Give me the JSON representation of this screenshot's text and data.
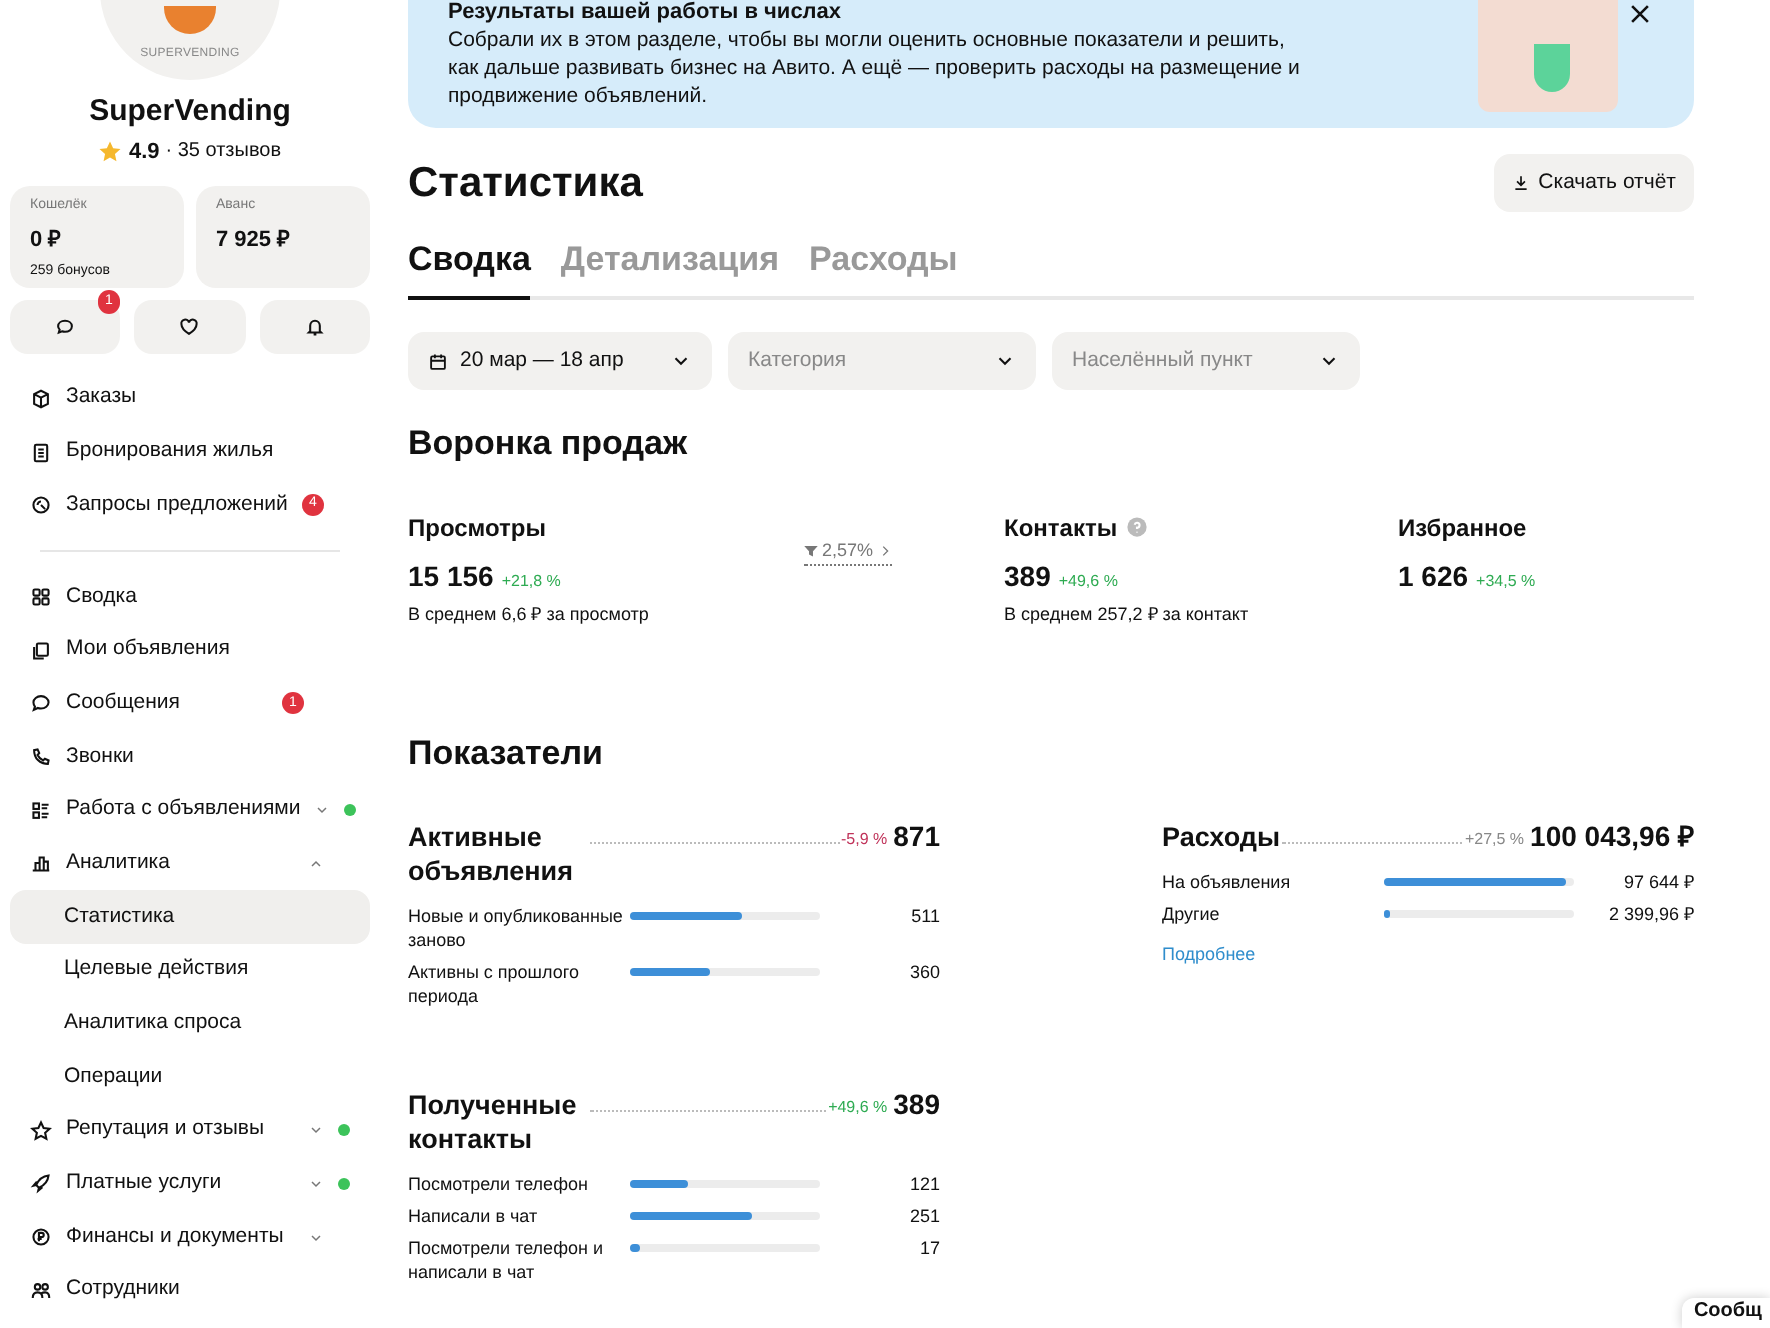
{
  "profile": {
    "logo_text": "SUPERVENDING",
    "name": "SuperVending",
    "rating": "4.9",
    "reviews": "· 35 отзывов"
  },
  "wallets": [
    {
      "label": "Кошелёк",
      "value": "0 ₽",
      "note": "259 бонусов"
    },
    {
      "label": "Аванс",
      "value": "7 925 ₽"
    }
  ],
  "quick_actions": [
    {
      "kind": "chat",
      "badge": "1"
    },
    {
      "kind": "heart"
    },
    {
      "kind": "bell"
    }
  ],
  "nav": [
    [
      {
        "label": "Заказы"
      },
      {
        "label": "Бронирования жилья"
      },
      {
        "label": "Запросы предложений",
        "badge": "4"
      }
    ],
    [
      {
        "label": "Сводка"
      },
      {
        "label": "Мои объявления"
      },
      {
        "label": "Сообщения",
        "badge": "1"
      },
      {
        "label": "Звонки"
      },
      {
        "label": "Работа с объявлениями",
        "expanded": false,
        "dot": true
      },
      {
        "label": "Аналитика",
        "expanded": true,
        "dot": false,
        "children": [
          {
            "label": "Статистика",
            "selected": true
          },
          {
            "label": "Целевые действия",
            "selected": false
          },
          {
            "label": "Аналитика спроса",
            "selected": false
          },
          {
            "label": "Операции",
            "selected": false
          }
        ]
      },
      {
        "label": "Репутация и отзывы",
        "expanded": false,
        "dot": true
      },
      {
        "label": "Платные услуги",
        "expanded": false,
        "dot": true
      },
      {
        "label": "Финансы и документы",
        "expanded": false,
        "dot": false
      },
      {
        "label": "Сотрудники"
      }
    ]
  ],
  "banner": {
    "title": "Результаты вашей работы в числах",
    "text": "Собрали их в этом разделе, чтобы вы могли оценить основные показатели и решить, как дальше развивать бизнес на Авито. А ещё — проверить расходы на размещение и продвижение объявлений."
  },
  "page_title": "Статистика",
  "download_button": "Скачать отчёт",
  "tabs": [
    {
      "label": "Сводка",
      "selected": true
    },
    {
      "label": "Детализация",
      "selected": false
    },
    {
      "label": "Расходы",
      "selected": false
    }
  ],
  "filters": [
    {
      "kind": "date",
      "value": "20 мар — 18 апр"
    },
    {
      "kind": "select",
      "placeholder": "Категория"
    },
    {
      "kind": "select",
      "placeholder": "Населённый пункт"
    }
  ],
  "funnel": {
    "title": "Воронка продаж",
    "conversion": "2,57%",
    "metrics": [
      {
        "label": "Просмотры",
        "value": "15 156",
        "change": "+21,8 %",
        "note": "В среднем 6,6 ₽ за просмотр"
      },
      {
        "label": "Контакты",
        "help": true,
        "value": "389",
        "change": "+49,6 %",
        "note": "В среднем 257,2 ₽ за контакт"
      },
      {
        "label": "Избранное",
        "value": "1 626",
        "change": "+34,5 %"
      }
    ]
  },
  "indicators": {
    "title": "Показатели",
    "blocks": [
      {
        "title": "Активные объявления",
        "color": "#c0335a",
        "change": "-5,9 %",
        "total": "871",
        "rows": [
          {
            "label": "Новые и опубликованные заново",
            "level": 0.59,
            "value": "511"
          },
          {
            "label": "Активны с прошлого периода",
            "level": 0.42,
            "value": "360"
          }
        ]
      },
      {
        "title": "Расходы",
        "color": "#888888",
        "change": "+27,5 %",
        "total": "100 043,96 ₽",
        "rows": [
          {
            "label": "На объявления",
            "level": 0.96,
            "value": "97 644 ₽"
          },
          {
            "label": "Другие",
            "level": 0.03,
            "value": "2 399,96 ₽"
          }
        ],
        "link": "Подробнее"
      },
      {
        "title": "Полученные контакты",
        "color": "#2eab52",
        "change": "+49,6 %",
        "total": "389",
        "rows": [
          {
            "label": "Посмотрели телефон",
            "level": 0.31,
            "value": "121"
          },
          {
            "label": "Написали в чат",
            "level": 0.64,
            "value": "251"
          },
          {
            "label": "Посмотрели телефон и написали в чат",
            "level": 0.05,
            "value": "17"
          }
        ]
      }
    ]
  },
  "chat_widget": "Сообщ"
}
